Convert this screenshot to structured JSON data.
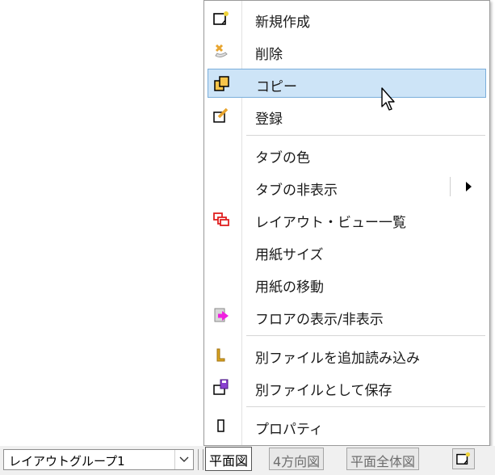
{
  "context_menu": {
    "items": [
      {
        "label": "新規作成",
        "icon": "new-sheet-icon"
      },
      {
        "label": "削除",
        "icon": "delete-icon"
      },
      {
        "label": "コピー",
        "icon": "copy-icon"
      },
      {
        "label": "登録",
        "icon": "register-icon"
      },
      {
        "label": "タブの色"
      },
      {
        "label": "タブの非表示",
        "has_submenu": true
      },
      {
        "label": "レイアウト・ビュー一覧",
        "icon": "layout-view-list-icon"
      },
      {
        "label": "用紙サイズ"
      },
      {
        "label": "用紙の移動"
      },
      {
        "label": "フロアの表示/非表示",
        "icon": "floor-toggle-icon"
      },
      {
        "label": "別ファイルを追加読み込み",
        "icon": "folder-icon"
      },
      {
        "label": "別ファイルとして保存",
        "icon": "save-icon"
      },
      {
        "label": "プロパティ",
        "icon": "properties-icon"
      }
    ],
    "highlighted_index": 2,
    "highlight_color": "#cde4f7"
  },
  "bottom_bar": {
    "layout_group": "レイアウトグループ1",
    "tabs": [
      {
        "label": "平面図",
        "active": true
      },
      {
        "label": "4方向図",
        "active": false
      },
      {
        "label": "平面全体図",
        "active": false
      }
    ]
  }
}
